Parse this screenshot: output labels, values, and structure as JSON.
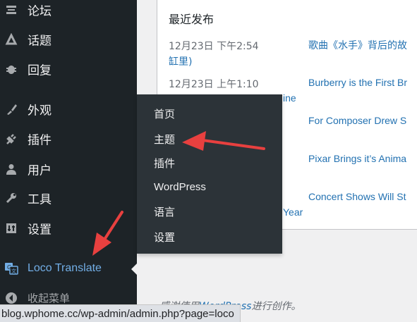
{
  "sidebar": {
    "items": [
      {
        "label": "论坛",
        "icon": "forums-icon"
      },
      {
        "label": "话题",
        "icon": "topics-icon"
      },
      {
        "label": "回复",
        "icon": "replies-icon"
      },
      {
        "label": "外观",
        "icon": "appearance-brush-icon"
      },
      {
        "label": "插件",
        "icon": "plugins-icon"
      },
      {
        "label": "用户",
        "icon": "users-icon"
      },
      {
        "label": "工具",
        "icon": "tools-wrench-icon"
      },
      {
        "label": "设置",
        "icon": "settings-icon"
      },
      {
        "label": "Loco Translate",
        "icon": "loco-translate-icon"
      },
      {
        "label": "收起菜单",
        "icon": "collapse-menu-icon"
      }
    ]
  },
  "flyout": {
    "items": [
      "首页",
      "主题",
      "插件",
      "WordPress",
      "语言",
      "设置"
    ]
  },
  "panel": {
    "title": "最近发布",
    "posts": [
      {
        "date": "12月23日 下午2:54",
        "link": "歌曲《水手》背后的故"
      },
      {
        "date": "12月23日 上午1:10",
        "link": "Burberry is the First Br"
      },
      {
        "date": "",
        "link": "For Composer Drew S"
      },
      {
        "date": "",
        "link": "Pixar Brings it’s Anima"
      },
      {
        "date": "",
        "link": "Concert Shows Will St"
      }
    ],
    "fragments": {
      "wrap1": "缸里)",
      "wrap2": "ine",
      "wrap3": "Year"
    }
  },
  "footer": {
    "prefix": "感谢使用",
    "link": "WordPress",
    "suffix": "进行创作。"
  },
  "statusbar": {
    "url": "blog.wphome.cc/wp-admin/admin.php?page=loco"
  },
  "colors": {
    "sidebar_bg": "#1d2327",
    "flyout_bg": "#2c3338",
    "link": "#2271b1",
    "loco_accent": "#72aee6",
    "annotation_arrow": "#e8403f"
  }
}
